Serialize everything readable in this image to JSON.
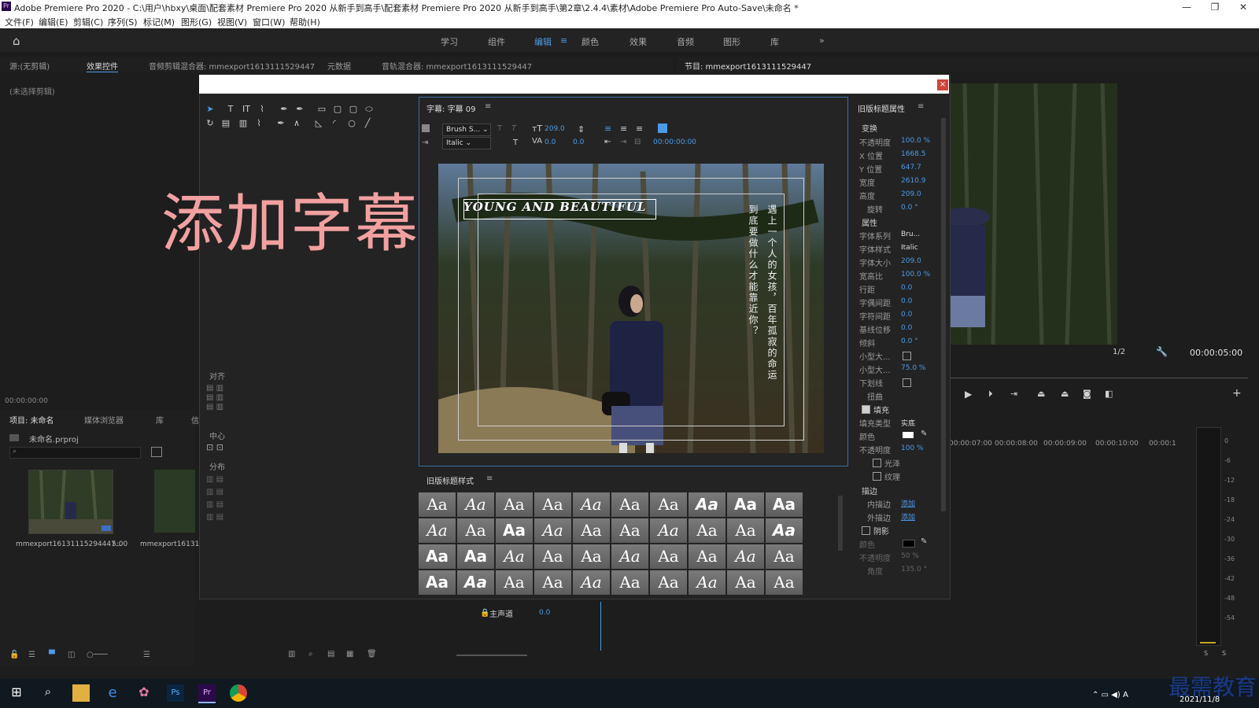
{
  "window": {
    "title": "Adobe Premiere Pro 2020 - C:\\用户\\hbxy\\桌面\\配套素材 Premiere Pro 2020 从新手到高手\\配套素材 Premiere Pro 2020 从新手到高手\\第2章\\2.4.4\\素材\\Adobe Premiere Pro Auto-Save\\未命名 *",
    "app_icon": "Pr",
    "min": "—",
    "max": "❐",
    "close": "✕"
  },
  "menu": [
    "文件(F)",
    "编辑(E)",
    "剪辑(C)",
    "序列(S)",
    "标记(M)",
    "图形(G)",
    "视图(V)",
    "窗口(W)",
    "帮助(H)"
  ],
  "workspaces": {
    "items": [
      "学习",
      "组件",
      "编辑",
      "颜色",
      "效果",
      "音频",
      "图形",
      "库"
    ],
    "active": "编辑",
    "more": "»",
    "menu": "≡"
  },
  "source_panel": {
    "tabs": [
      "源:(无剪辑)",
      "效果控件",
      "音频剪辑混合器: mmexport1613111529447",
      "元数据",
      "音轨混合器: mmexport1613111529447"
    ],
    "no_clip": "(未选择剪辑)",
    "timecode": "00:00:00:00"
  },
  "program_panel": {
    "tab": "节目: mmexport1613111529447",
    "scale": "1/2",
    "timecode": "00:00:05:00"
  },
  "big_overlay_text": "添加字幕",
  "titler": {
    "header": "字幕: 字幕 09",
    "font": "Brush S...",
    "style": "Italic",
    "size": "209.0",
    "kerning": "0.0",
    "leading": "0.0",
    "timecode": "00:00:00:00",
    "text_horizontal": "YOUNG AND BEAUTIFUL",
    "text_vertical_1": "遇上一个人的女孩，百年孤寂的命运",
    "text_vertical_2": "到底要做什么才能靠近你？",
    "align_label": "对齐",
    "center_label": "中心",
    "distribute_label": "分布"
  },
  "styles": {
    "header": "旧版标题样式",
    "sample": "Aa"
  },
  "properties": {
    "header": "旧版标题属性",
    "transform": "变换",
    "rows_transform": [
      {
        "label": "不透明度",
        "value": "100.0 %"
      },
      {
        "label": "X 位置",
        "value": "1668.5"
      },
      {
        "label": "Y 位置",
        "value": "647.7"
      },
      {
        "label": "宽度",
        "value": "2610.9"
      },
      {
        "label": "高度",
        "value": "209.0"
      },
      {
        "label": "旋转",
        "value": "0.0 °"
      }
    ],
    "attributes": "属性",
    "rows_attr": [
      {
        "label": "字体系列",
        "value": "Bru..."
      },
      {
        "label": "字体样式",
        "value": "Italic"
      },
      {
        "label": "字体大小",
        "value": "209.0"
      },
      {
        "label": "宽高比",
        "value": "100.0 %"
      },
      {
        "label": "行距",
        "value": "0.0"
      },
      {
        "label": "字偶间距",
        "value": "0.0"
      },
      {
        "label": "字符间距",
        "value": "0.0"
      },
      {
        "label": "基线位移",
        "value": "0.0"
      },
      {
        "label": "倾斜",
        "value": "0.0 °"
      },
      {
        "label": "小型大...",
        "value": ""
      },
      {
        "label": "小型大...",
        "value": "75.0 %"
      },
      {
        "label": "下划线",
        "value": ""
      },
      {
        "label": "扭曲",
        "value": ""
      }
    ],
    "fill": "填充",
    "fill_type_label": "填充类型",
    "fill_type": "实底",
    "color_label": "颜色",
    "opacity_label": "不透明度",
    "fill_opacity": "100 %",
    "sheen": "光泽",
    "texture": "纹理",
    "stroke": "描边",
    "inner_stroke": "内描边",
    "outer_stroke": "外描边",
    "add": "添加",
    "shadow": "阴影",
    "shadow_color": "颜色",
    "shadow_opacity_label": "不透明度",
    "shadow_opacity": "50 %",
    "angle_label": "角度",
    "angle": "135.0 °"
  },
  "project_panel": {
    "tabs": [
      "项目: 未命名",
      "媒体浏览器",
      "库",
      "信"
    ],
    "project_file": "未命名.prproj",
    "clip1_name": "mmexport16131115294447...",
    "clip1_duration": "5:00",
    "clip2_name": "mmexport1613111"
  },
  "timeline": {
    "ruler": [
      "00:00:07:00",
      "00:00:08:00",
      "00:00:09:00",
      "00:00:10:00",
      "00:00:1"
    ],
    "master": "主声道",
    "master_value": "0.0"
  },
  "meter": {
    "labels": [
      "0",
      "-6",
      "-12",
      "-18",
      "-24",
      "-30",
      "-36",
      "-42",
      "-48",
      "-54"
    ],
    "solo": [
      "S",
      "S"
    ]
  },
  "taskbar": {
    "date": "2021/11/8",
    "watermark": "最需教育"
  },
  "colors": {
    "accent": "#4c9be8",
    "close": "#d0453a",
    "overlay_text": "#f2a0a0"
  }
}
